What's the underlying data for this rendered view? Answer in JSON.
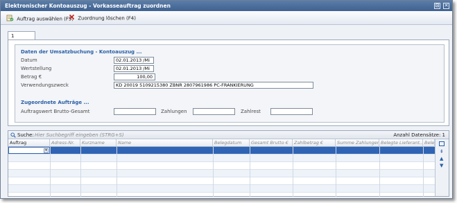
{
  "window": {
    "title": "Elektronischer Kontoauszug - Vorkasseauftrag zuordnen",
    "restore_glyph": "⊡",
    "close_glyph": "✕"
  },
  "toolbar": {
    "select_label": "Auftrag auswählen (F5)",
    "delete_label": "Zuordnung löschen (F4)"
  },
  "tabs": [
    {
      "label": "1 Allgemein",
      "active": true
    }
  ],
  "umsatz": {
    "section_title": "Daten der Umsatzbuchung - Kontoauszug ...",
    "datum_label": "Datum",
    "datum_value": "02.01.2013 /Mi",
    "wert_label": "Wertstellung",
    "wert_value": "02.01.2013 /Mi",
    "betrag_label": "Betrag €",
    "betrag_value": "100,00",
    "zweck_label": "Verwendungszweck",
    "zweck_value": "KD 20019 5109215380 ZBNR 2807961986 PC-FRANKIERUNG"
  },
  "auftraege": {
    "section_title": "Zugeordnete Aufträge ...",
    "wert_label": "Auftragswert Brutto-Gesamt",
    "wert_value": "",
    "zahlungen_label": "Zahlungen",
    "zahlungen_value": "",
    "zahlrest_label": "Zahlrest",
    "zahlrest_value": ""
  },
  "grid": {
    "search_label": "Suche:",
    "search_placeholder": "Hier Suchbegriff eingeben (STRG+S)",
    "count_label": "Anzahl Datensätze:",
    "count_value": "1",
    "columns": [
      "Auftrag",
      "Adress-Nr.",
      "Kurzname",
      "Name",
      "Belegdatum",
      "Gesamt Brutto €",
      "Zahlbetrag €",
      "Summe Zahlungen",
      "Belegte Lieferant...",
      "Bele"
    ]
  },
  "colors": {
    "accent": "#2a5fa6",
    "selection": "#2f64b5",
    "titlebar": "#4a6f9c"
  }
}
